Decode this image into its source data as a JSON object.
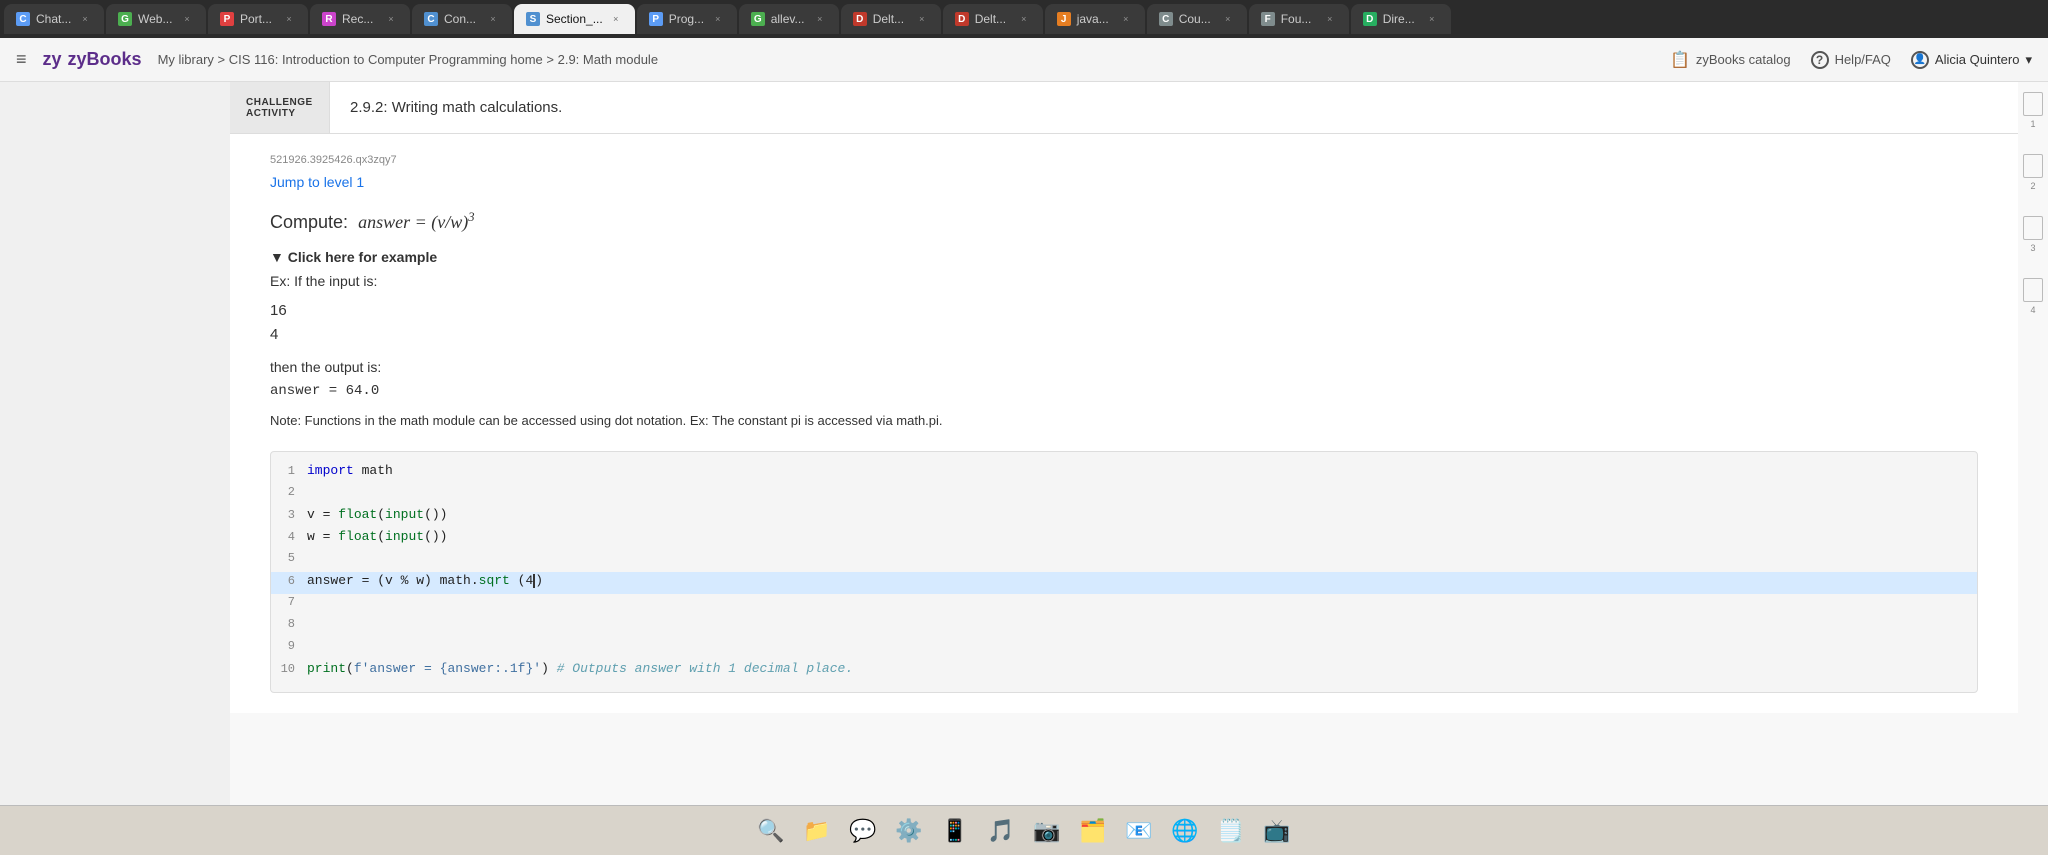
{
  "tabs": [
    {
      "id": "chat",
      "label": "Chat...",
      "favicon_color": "#5c9cf5",
      "favicon_char": "C",
      "active": false
    },
    {
      "id": "web",
      "label": "Web...",
      "favicon_color": "#4caf50",
      "favicon_char": "G",
      "active": false
    },
    {
      "id": "port",
      "label": "Port...",
      "favicon_color": "#e04040",
      "favicon_char": "P",
      "active": false
    },
    {
      "id": "rec",
      "label": "Rec...",
      "favicon_color": "#cc44cc",
      "favicon_char": "R",
      "active": false
    },
    {
      "id": "con",
      "label": "Con...",
      "favicon_color": "#5090d0",
      "favicon_char": "C",
      "active": false
    },
    {
      "id": "section",
      "label": "Section_...",
      "favicon_color": "#5090d0",
      "favicon_char": "S",
      "active": true
    },
    {
      "id": "prog",
      "label": "Prog...",
      "favicon_color": "#5c9cf5",
      "favicon_char": "P",
      "active": false
    },
    {
      "id": "allev",
      "label": "allev...",
      "favicon_color": "#4caf50",
      "favicon_char": "G",
      "active": false
    },
    {
      "id": "delt1",
      "label": "Delt...",
      "favicon_color": "#c0392b",
      "favicon_char": "D",
      "active": false
    },
    {
      "id": "delt2",
      "label": "Delt...",
      "favicon_color": "#c0392b",
      "favicon_char": "D",
      "active": false
    },
    {
      "id": "java",
      "label": "java...",
      "favicon_color": "#e67e22",
      "favicon_char": "J",
      "active": false
    },
    {
      "id": "cou",
      "label": "Cou...",
      "favicon_color": "#7f8c8d",
      "favicon_char": "C",
      "active": false
    },
    {
      "id": "fou",
      "label": "Fou...",
      "favicon_color": "#7f8c8d",
      "favicon_char": "F",
      "active": false
    },
    {
      "id": "dire",
      "label": "Dire...",
      "favicon_color": "#27ae60",
      "favicon_char": "D",
      "active": false
    }
  ],
  "nav": {
    "logo": "zyBooks",
    "breadcrumb": "My library > CIS 116: Introduction to Computer Programming home > 2.9: Math module",
    "catalog_label": "zyBooks catalog",
    "help_label": "Help/FAQ",
    "user_label": "Alicia Quintero"
  },
  "challenge": {
    "label_top": "CHALLENGE",
    "label_bottom": "ACTIVITY",
    "title": "2.9.2: Writing math calculations."
  },
  "activity": {
    "id": "521926.3925426.qx3zqy7",
    "jump_label": "Jump to level 1",
    "compute_prefix": "Compute:",
    "example_toggle": "▼ Click here for example",
    "example_intro": "Ex: If the input is:",
    "example_values": [
      "16",
      "4"
    ],
    "then_text": "then the output is:",
    "output_line": "answer = 64.0",
    "note_text": "Note: Functions in the math module can be accessed using dot notation. Ex: The constant pi is accessed via math.pi.",
    "code_lines": [
      {
        "num": 1,
        "content": "import math",
        "highlighted": false
      },
      {
        "num": 2,
        "content": "",
        "highlighted": false
      },
      {
        "num": 3,
        "content": "v = float(input())",
        "highlighted": false
      },
      {
        "num": 4,
        "content": "w = float(input())",
        "highlighted": false
      },
      {
        "num": 5,
        "content": "",
        "highlighted": false
      },
      {
        "num": 6,
        "content": "answer = (v % w) math.sqrt (4)",
        "highlighted": true,
        "has_cursor": true
      },
      {
        "num": 7,
        "content": "",
        "highlighted": false
      },
      {
        "num": 8,
        "content": "",
        "highlighted": false
      },
      {
        "num": 9,
        "content": "",
        "highlighted": false
      },
      {
        "num": 10,
        "content": "print(f'answer = {answer:.1f}') # Outputs answer with 1 decimal place.",
        "highlighted": false
      }
    ]
  },
  "right_markers": [
    {
      "num": "1"
    },
    {
      "num": "2"
    },
    {
      "num": "3"
    },
    {
      "num": "4"
    }
  ],
  "dock_icons": [
    "🔍",
    "📁",
    "💬",
    "⚙️",
    "📱",
    "🎵",
    "📷",
    "🗂️",
    "📧",
    "🌐"
  ]
}
